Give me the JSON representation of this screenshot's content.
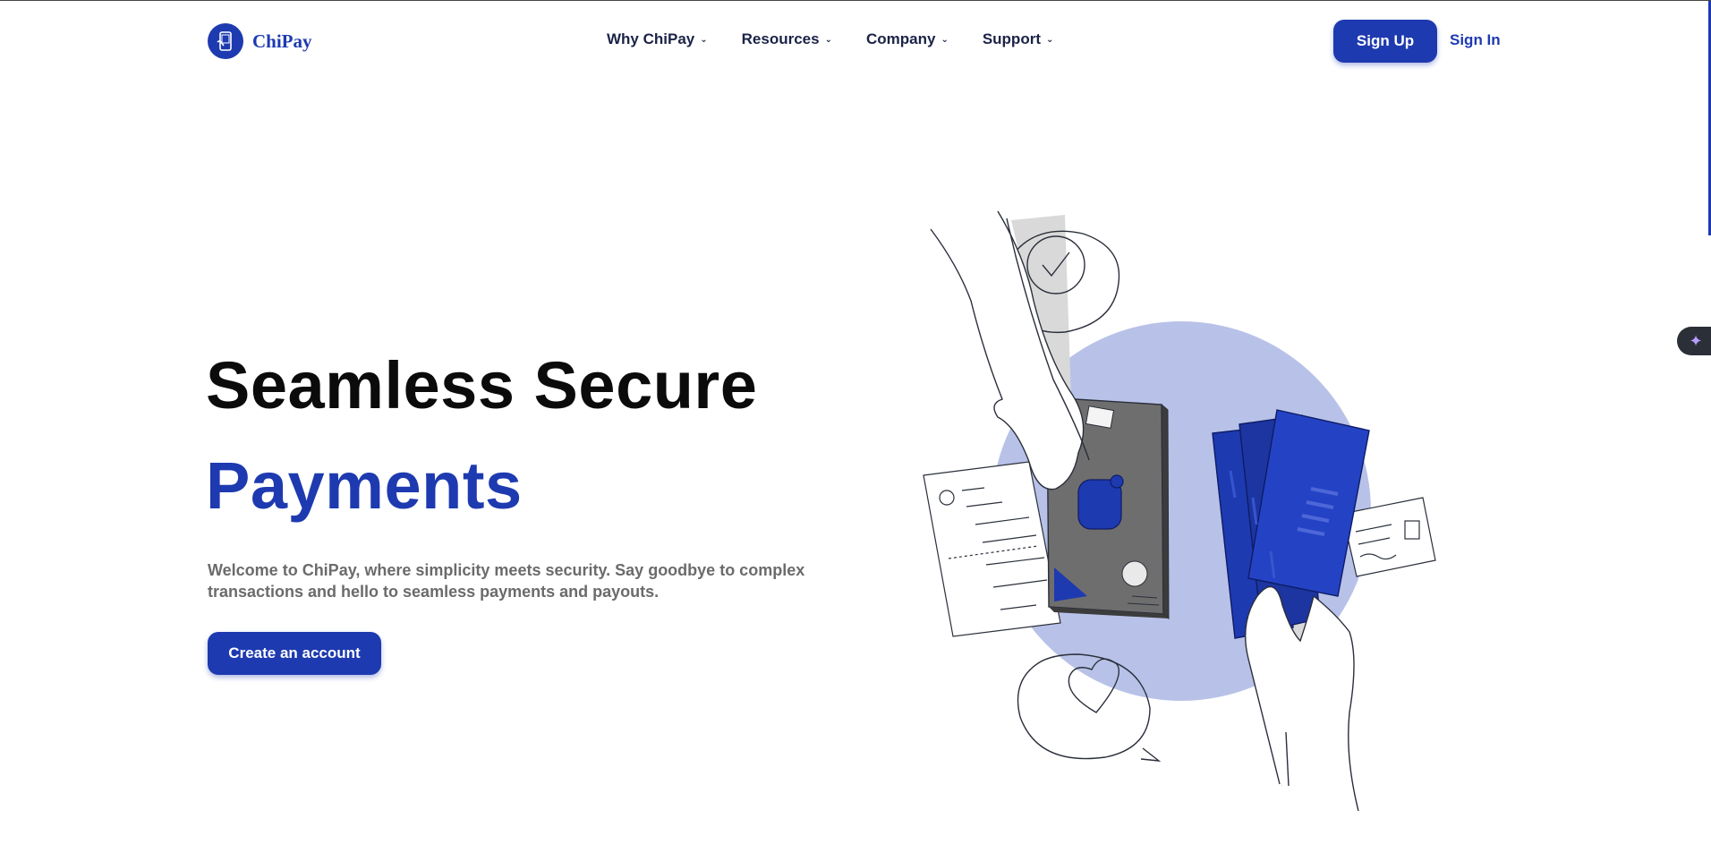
{
  "brand": {
    "name": "ChiPay",
    "color": "#1e3ab0",
    "icon": "phone-payment-icon"
  },
  "nav": {
    "items": [
      {
        "label": "Why ChiPay",
        "icon": "chevron-down-icon"
      },
      {
        "label": "Resources",
        "icon": "chevron-down-icon"
      },
      {
        "label": "Company",
        "icon": "chevron-down-icon"
      },
      {
        "label": "Support",
        "icon": "chevron-down-icon"
      }
    ],
    "chevron_glyph": "⌄"
  },
  "header": {
    "signup_label": "Sign Up",
    "signin_label": "Sign In"
  },
  "hero": {
    "title": "Seamless Secure",
    "accent": "Payments",
    "description": "Welcome to ChiPay, where simplicity meets security. Say goodbye to complex transactions and hello to seamless payments and payouts.",
    "cta_label": "Create an account"
  },
  "illustration": {
    "circle_color": "#b8c2e8",
    "wallet_color": "#6e6e6e",
    "cash_color": "#1e3ab0",
    "icons": [
      "check-bubble-icon",
      "heart-bubble-icon",
      "receipt-icon",
      "id-card-icon",
      "wallet-icon",
      "banknotes-icon"
    ]
  },
  "sidebar_tab": {
    "icon": "sparkle-icon",
    "glyph": "✦"
  }
}
